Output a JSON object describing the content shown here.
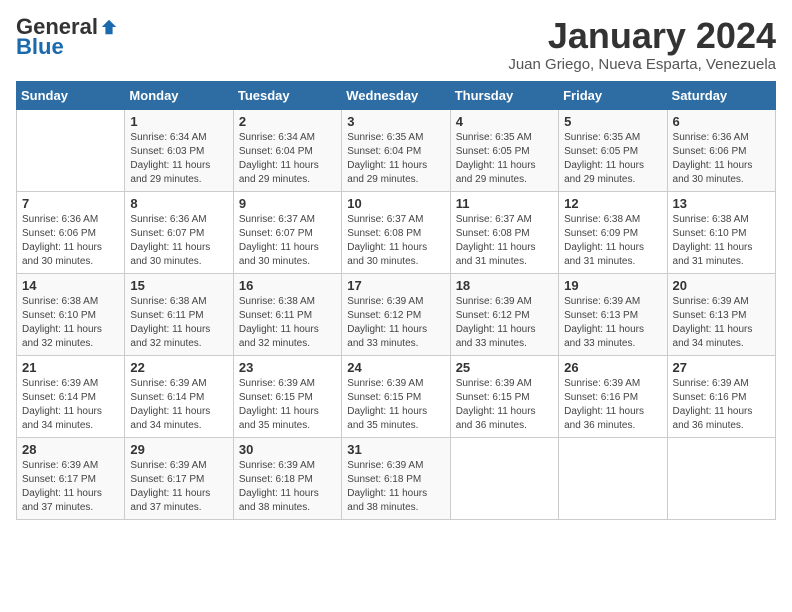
{
  "header": {
    "logo_general": "General",
    "logo_blue": "Blue",
    "month_title": "January 2024",
    "location": "Juan Griego, Nueva Esparta, Venezuela"
  },
  "days_of_week": [
    "Sunday",
    "Monday",
    "Tuesday",
    "Wednesday",
    "Thursday",
    "Friday",
    "Saturday"
  ],
  "weeks": [
    [
      {
        "day": "",
        "info": ""
      },
      {
        "day": "1",
        "info": "Sunrise: 6:34 AM\nSunset: 6:03 PM\nDaylight: 11 hours\nand 29 minutes."
      },
      {
        "day": "2",
        "info": "Sunrise: 6:34 AM\nSunset: 6:04 PM\nDaylight: 11 hours\nand 29 minutes."
      },
      {
        "day": "3",
        "info": "Sunrise: 6:35 AM\nSunset: 6:04 PM\nDaylight: 11 hours\nand 29 minutes."
      },
      {
        "day": "4",
        "info": "Sunrise: 6:35 AM\nSunset: 6:05 PM\nDaylight: 11 hours\nand 29 minutes."
      },
      {
        "day": "5",
        "info": "Sunrise: 6:35 AM\nSunset: 6:05 PM\nDaylight: 11 hours\nand 29 minutes."
      },
      {
        "day": "6",
        "info": "Sunrise: 6:36 AM\nSunset: 6:06 PM\nDaylight: 11 hours\nand 30 minutes."
      }
    ],
    [
      {
        "day": "7",
        "info": "Sunrise: 6:36 AM\nSunset: 6:06 PM\nDaylight: 11 hours\nand 30 minutes."
      },
      {
        "day": "8",
        "info": "Sunrise: 6:36 AM\nSunset: 6:07 PM\nDaylight: 11 hours\nand 30 minutes."
      },
      {
        "day": "9",
        "info": "Sunrise: 6:37 AM\nSunset: 6:07 PM\nDaylight: 11 hours\nand 30 minutes."
      },
      {
        "day": "10",
        "info": "Sunrise: 6:37 AM\nSunset: 6:08 PM\nDaylight: 11 hours\nand 30 minutes."
      },
      {
        "day": "11",
        "info": "Sunrise: 6:37 AM\nSunset: 6:08 PM\nDaylight: 11 hours\nand 31 minutes."
      },
      {
        "day": "12",
        "info": "Sunrise: 6:38 AM\nSunset: 6:09 PM\nDaylight: 11 hours\nand 31 minutes."
      },
      {
        "day": "13",
        "info": "Sunrise: 6:38 AM\nSunset: 6:10 PM\nDaylight: 11 hours\nand 31 minutes."
      }
    ],
    [
      {
        "day": "14",
        "info": "Sunrise: 6:38 AM\nSunset: 6:10 PM\nDaylight: 11 hours\nand 32 minutes."
      },
      {
        "day": "15",
        "info": "Sunrise: 6:38 AM\nSunset: 6:11 PM\nDaylight: 11 hours\nand 32 minutes."
      },
      {
        "day": "16",
        "info": "Sunrise: 6:38 AM\nSunset: 6:11 PM\nDaylight: 11 hours\nand 32 minutes."
      },
      {
        "day": "17",
        "info": "Sunrise: 6:39 AM\nSunset: 6:12 PM\nDaylight: 11 hours\nand 33 minutes."
      },
      {
        "day": "18",
        "info": "Sunrise: 6:39 AM\nSunset: 6:12 PM\nDaylight: 11 hours\nand 33 minutes."
      },
      {
        "day": "19",
        "info": "Sunrise: 6:39 AM\nSunset: 6:13 PM\nDaylight: 11 hours\nand 33 minutes."
      },
      {
        "day": "20",
        "info": "Sunrise: 6:39 AM\nSunset: 6:13 PM\nDaylight: 11 hours\nand 34 minutes."
      }
    ],
    [
      {
        "day": "21",
        "info": "Sunrise: 6:39 AM\nSunset: 6:14 PM\nDaylight: 11 hours\nand 34 minutes."
      },
      {
        "day": "22",
        "info": "Sunrise: 6:39 AM\nSunset: 6:14 PM\nDaylight: 11 hours\nand 34 minutes."
      },
      {
        "day": "23",
        "info": "Sunrise: 6:39 AM\nSunset: 6:15 PM\nDaylight: 11 hours\nand 35 minutes."
      },
      {
        "day": "24",
        "info": "Sunrise: 6:39 AM\nSunset: 6:15 PM\nDaylight: 11 hours\nand 35 minutes."
      },
      {
        "day": "25",
        "info": "Sunrise: 6:39 AM\nSunset: 6:15 PM\nDaylight: 11 hours\nand 36 minutes."
      },
      {
        "day": "26",
        "info": "Sunrise: 6:39 AM\nSunset: 6:16 PM\nDaylight: 11 hours\nand 36 minutes."
      },
      {
        "day": "27",
        "info": "Sunrise: 6:39 AM\nSunset: 6:16 PM\nDaylight: 11 hours\nand 36 minutes."
      }
    ],
    [
      {
        "day": "28",
        "info": "Sunrise: 6:39 AM\nSunset: 6:17 PM\nDaylight: 11 hours\nand 37 minutes."
      },
      {
        "day": "29",
        "info": "Sunrise: 6:39 AM\nSunset: 6:17 PM\nDaylight: 11 hours\nand 37 minutes."
      },
      {
        "day": "30",
        "info": "Sunrise: 6:39 AM\nSunset: 6:18 PM\nDaylight: 11 hours\nand 38 minutes."
      },
      {
        "day": "31",
        "info": "Sunrise: 6:39 AM\nSunset: 6:18 PM\nDaylight: 11 hours\nand 38 minutes."
      },
      {
        "day": "",
        "info": ""
      },
      {
        "day": "",
        "info": ""
      },
      {
        "day": "",
        "info": ""
      }
    ]
  ]
}
